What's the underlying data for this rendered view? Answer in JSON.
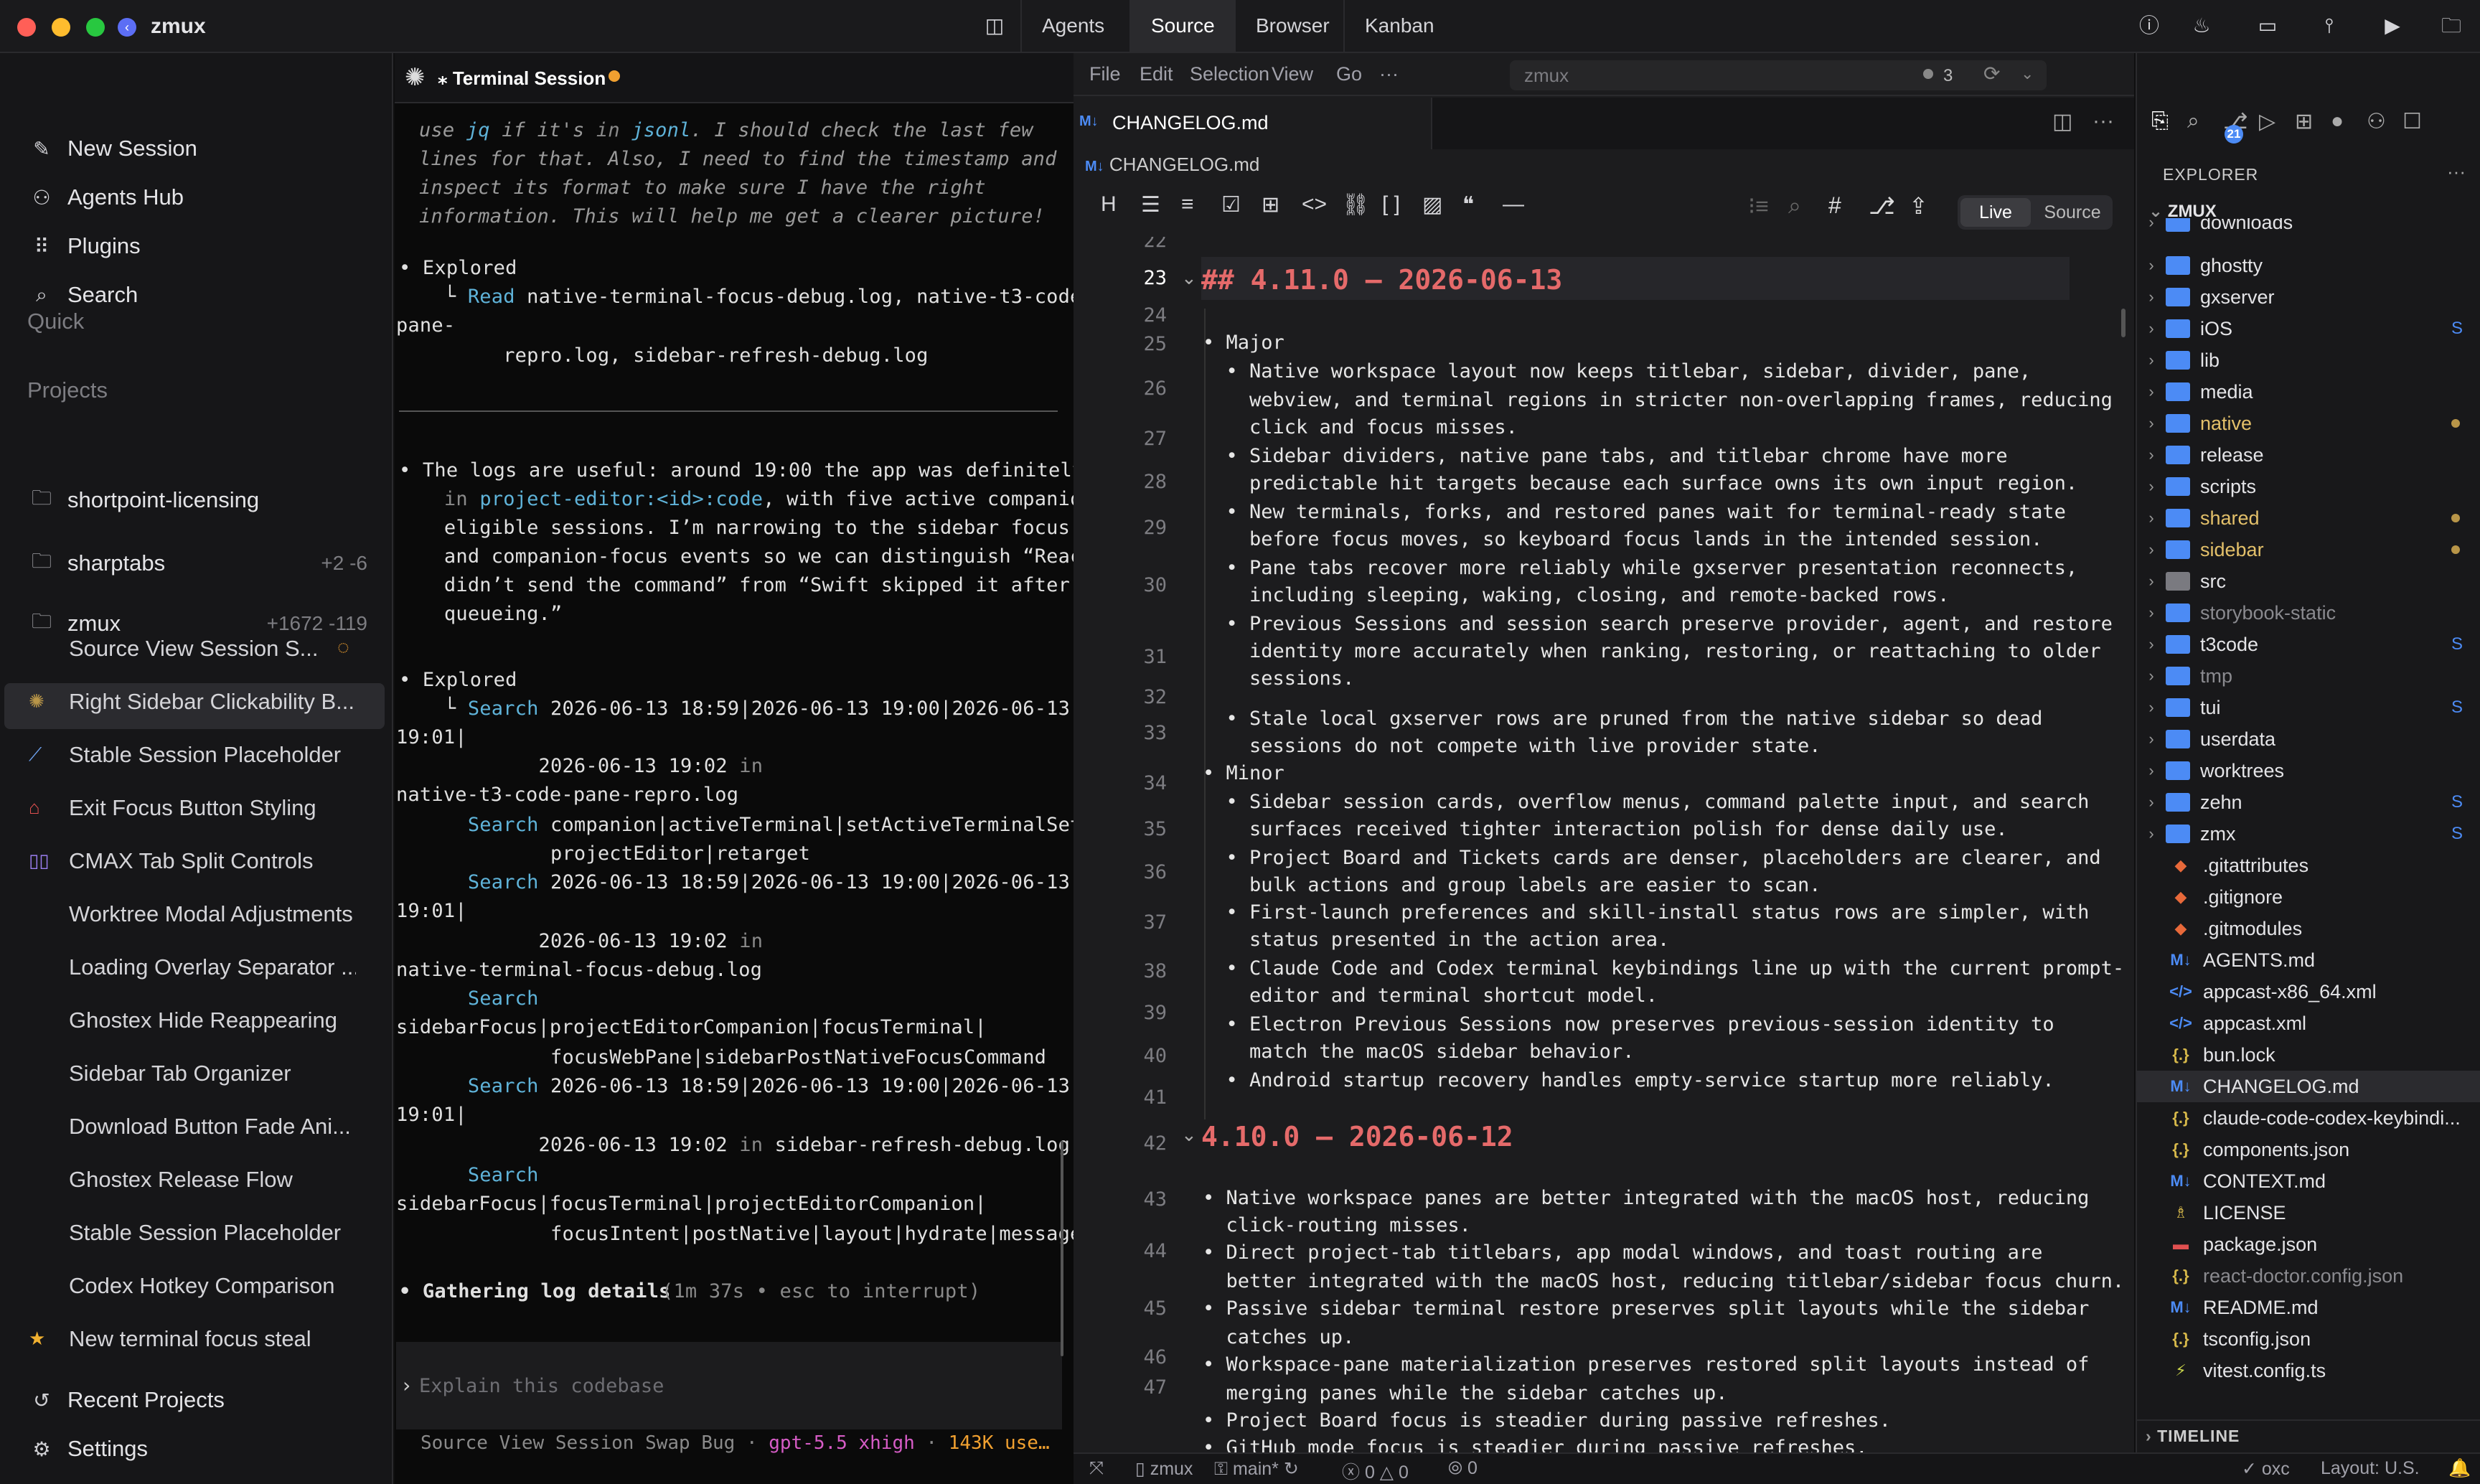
{
  "app": {
    "title": "zmux"
  },
  "top_tabs": [
    "Agents",
    "Source",
    "Browser",
    "Kanban"
  ],
  "sidebar": {
    "actions": [
      {
        "label": "New Session",
        "icon": "pencil-icon"
      },
      {
        "label": "Agents Hub",
        "icon": "agents-icon"
      },
      {
        "label": "Plugins",
        "icon": "grid-icon"
      },
      {
        "label": "Search",
        "icon": "search-icon"
      }
    ],
    "quick_header": "Quick",
    "projects_header": "Projects",
    "projects": [
      {
        "name": "shortpoint-licensing",
        "add": "",
        "del": ""
      },
      {
        "name": "sharptabs",
        "add": "+2",
        "del": "-6"
      },
      {
        "name": "zmux",
        "add": "+1672",
        "del": "-119"
      }
    ],
    "sessions": [
      "Source View Session S...",
      "Right Sidebar Clickability B...",
      "Stable Session Placeholder",
      "Exit Focus Button Styling",
      "CMAX Tab Split Controls",
      "Worktree Modal Adjustments",
      "Loading Overlay Separator ...",
      "Ghostex Hide Reappearing",
      "Sidebar Tab Organizer",
      "Download Button Fade Ani...",
      "Ghostex Release Flow",
      "Stable Session Placeholder",
      "Codex Hotkey Comparison",
      "New terminal focus steal"
    ],
    "footer": [
      "Recent Projects",
      "Settings"
    ]
  },
  "terminal": {
    "title": "Terminal Session",
    "lines": [
      "use jq if it's in jsonl. I should check the last few",
      "lines for that. Also, I need to find the timestamp and",
      "inspect its format to make sure I have the right",
      "information. This will help me get a clearer picture!",
      "• Explored",
      "  └ Read native-terminal-focus-debug.log, native-t3-code-",
      "pane-",
      "       repro.log, sidebar-refresh-debug.log",
      "• The logs are useful: around 19:00 the app was definitely",
      "  in project-editor:<id>:code, with five active companion-",
      "  eligible sessions. I’m narrowing to the sidebar focus",
      "  and companion-focus events so we can distinguish “React",
      "  didn’t send the command” from “Swift skipped it after",
      "  queueing.”",
      "• Explored",
      "  └ Search 2026-06-13 18:59|2026-06-13 19:00|2026-06-13",
      "19:01|",
      "          2026-06-13 19:02 in",
      "native-t3-code-pane-repro.log",
      "    Search companion|activeTerminal|setActiveTerminalSet|",
      "           projectEditor|retarget",
      "    Search 2026-06-13 18:59|2026-06-13 19:00|2026-06-13",
      "19:01|",
      "          2026-06-13 19:02 in",
      "native-terminal-focus-debug.log",
      "    Search",
      "sidebarFocus|projectEditorCompanion|focusTerminal|",
      "           focusWebPane|sidebarPostNativeFocusCommand",
      "    Search 2026-06-13 18:59|2026-06-13 19:00|2026-06-13",
      "19:01|",
      "          2026-06-13 19:02 in sidebar-refresh-debug.log",
      "    Search",
      "sidebarFocus|focusTerminal|projectEditorCompanion|",
      "           focusIntent|postNative|layout|hydrate|message",
      "• Gathering log details",
      "(1m 37s • esc to interrupt)"
    ],
    "input_placeholder": "Explain this codebase",
    "footer_session": "Source View Session Swap Bug",
    "footer_model": "gpt-5.5 xhigh",
    "footer_tokens": "143K use…"
  },
  "editor": {
    "menu": [
      "File",
      "Edit",
      "Selection",
      "View",
      "Go",
      "···"
    ],
    "search_placeholder": "zmux",
    "search_count": "3",
    "tab": "CHANGELOG.md",
    "breadcrumb": "CHANGELOG.md",
    "mode_live": "Live",
    "mode_source": "Source",
    "gutter": [
      "22",
      "23",
      "24",
      "25",
      "26",
      "27",
      "28",
      "29",
      "30",
      "31",
      "32",
      "33",
      "34",
      "35",
      "36",
      "37",
      "38",
      "39",
      "40",
      "41",
      "42",
      "43",
      "44",
      "45",
      "46",
      "47"
    ],
    "lines": [
      "## 4.11.0 – 2026-06-13",
      "• Major",
      "  • Native workspace layout now keeps titlebar, sidebar, divider, pane,",
      "    webview, and terminal regions in stricter non-overlapping frames, reducing",
      "    click and focus misses.",
      "  • Sidebar dividers, native pane tabs, and titlebar chrome have more",
      "    predictable hit targets because each surface owns its own input region.",
      "  • New terminals, forks, and restored panes wait for terminal-ready state",
      "    before focus moves, so keyboard focus lands in the intended session.",
      "  • Pane tabs recover more reliably while gxserver presentation reconnects,",
      "    including sleeping, waking, closing, and remote-backed rows.",
      "  • Previous Sessions and session search preserve provider, agent, and restore",
      "    identity more accurately when ranking, restoring, or reattaching to older",
      "    sessions.",
      "  • Stale local gxserver rows are pruned from the native sidebar so dead",
      "    sessions do not compete with live provider state.",
      "• Minor",
      "  • Sidebar session cards, overflow menus, command palette input, and search",
      "    surfaces received tighter interaction polish for dense daily use.",
      "  • Project Board and Tickets cards are denser, placeholders are clearer, and",
      "    bulk actions and group labels are easier to scan.",
      "  • First-launch preferences and skill-install status rows are simpler, with",
      "    status presented in the action area.",
      "  • Claude Code and Codex terminal keybindings line up with the current prompt-",
      "    editor and terminal shortcut model.",
      "  • Electron Previous Sessions now preserves previous-session identity to",
      "    match the macOS sidebar behavior.",
      "  • Android startup recovery handles empty-service startup more reliably.",
      "4.10.0 – 2026-06-12",
      "• Native workspace panes are better integrated with the macOS host, reducing",
      "  click-routing misses.",
      "• Direct project-tab titlebars, app modal windows, and toast routing are",
      "  better integrated with the macOS host, reducing titlebar/sidebar focus churn.",
      "• Passive sidebar terminal restore preserves split layouts while the sidebar",
      "  catches up.",
      "• Workspace-pane materialization preserves restored split layouts instead of",
      "  merging panes while the sidebar catches up.",
      "• Project Board focus is steadier during passive refreshes.",
      "• GitHub mode focus is steadier during passive refreshes."
    ]
  },
  "explorer": {
    "title": "EXPLORER",
    "root": "ZMUX",
    "folders": [
      {
        "name": "downloads",
        "status": ""
      },
      {
        "name": "ghostty",
        "status": ""
      },
      {
        "name": "gxserver",
        "status": ""
      },
      {
        "name": "iOS",
        "status": "S"
      },
      {
        "name": "lib",
        "status": ""
      },
      {
        "name": "media",
        "status": ""
      },
      {
        "name": "native",
        "status": "dot"
      },
      {
        "name": "release",
        "status": ""
      },
      {
        "name": "scripts",
        "status": ""
      },
      {
        "name": "shared",
        "status": "dot"
      },
      {
        "name": "sidebar",
        "status": "dot"
      },
      {
        "name": "src",
        "status": ""
      },
      {
        "name": "storybook-static",
        "status": ""
      },
      {
        "name": "t3code",
        "status": "S"
      },
      {
        "name": "tmp",
        "status": ""
      },
      {
        "name": "tui",
        "status": "S"
      },
      {
        "name": "userdata",
        "status": ""
      },
      {
        "name": "worktrees",
        "status": ""
      },
      {
        "name": "zehn",
        "status": "S"
      },
      {
        "name": "zmx",
        "status": "S"
      }
    ],
    "files": [
      {
        "name": ".gitattributes",
        "icon": "git-icon",
        "glyph": "◆",
        "color": "#e8693a"
      },
      {
        "name": ".gitignore",
        "icon": "git-icon",
        "glyph": "◆",
        "color": "#e8693a"
      },
      {
        "name": ".gitmodules",
        "icon": "git-icon",
        "glyph": "◆",
        "color": "#e8693a"
      },
      {
        "name": "AGENTS.md",
        "icon": "markdown-icon",
        "glyph": "M↓",
        "color": "#4c8bf5"
      },
      {
        "name": "appcast-x86_64.xml",
        "icon": "xml-icon",
        "glyph": "</>",
        "color": "#4c8bf5"
      },
      {
        "name": "appcast.xml",
        "icon": "xml-icon",
        "glyph": "</>",
        "color": "#4c8bf5"
      },
      {
        "name": "bun.lock",
        "icon": "json-icon",
        "glyph": "{.}",
        "color": "#d6b84a"
      },
      {
        "name": "CHANGELOG.md",
        "icon": "markdown-icon",
        "glyph": "M↓",
        "color": "#4c8bf5"
      },
      {
        "name": "claude-code-codex-keybindi...",
        "icon": "json-icon",
        "glyph": "{.}",
        "color": "#d6b84a"
      },
      {
        "name": "components.json",
        "icon": "json-icon",
        "glyph": "{.}",
        "color": "#d6b84a"
      },
      {
        "name": "CONTEXT.md",
        "icon": "markdown-icon",
        "glyph": "M↓",
        "color": "#4c8bf5"
      },
      {
        "name": "LICENSE",
        "icon": "license-icon",
        "glyph": "♗",
        "color": "#d6b84a"
      },
      {
        "name": "package.json",
        "icon": "npm-icon",
        "glyph": "▬",
        "color": "#e05050"
      },
      {
        "name": "react-doctor.config.json",
        "icon": "json-icon",
        "glyph": "{.}",
        "color": "#d6b84a"
      },
      {
        "name": "README.md",
        "icon": "markdown-icon",
        "glyph": "M↓",
        "color": "#4c8bf5"
      },
      {
        "name": "tsconfig.json",
        "icon": "json-icon",
        "glyph": "{.}",
        "color": "#d6b84a"
      },
      {
        "name": "vitest.config.ts",
        "icon": "vitest-icon",
        "glyph": "⚡",
        "color": "#c9d44a"
      }
    ],
    "timeline": "TIMELINE",
    "badge": "21"
  },
  "statusbar": {
    "project": "zmux",
    "branch": "main*",
    "errors": "0",
    "warnings": "0",
    "ports": "0",
    "oxc": "oxc",
    "layout": "Layout: U.S."
  },
  "colors": {
    "accent": "#4c8bf5",
    "heading": "#e56a6a",
    "add": "#8a8a8a",
    "orange": "#f0a030"
  }
}
